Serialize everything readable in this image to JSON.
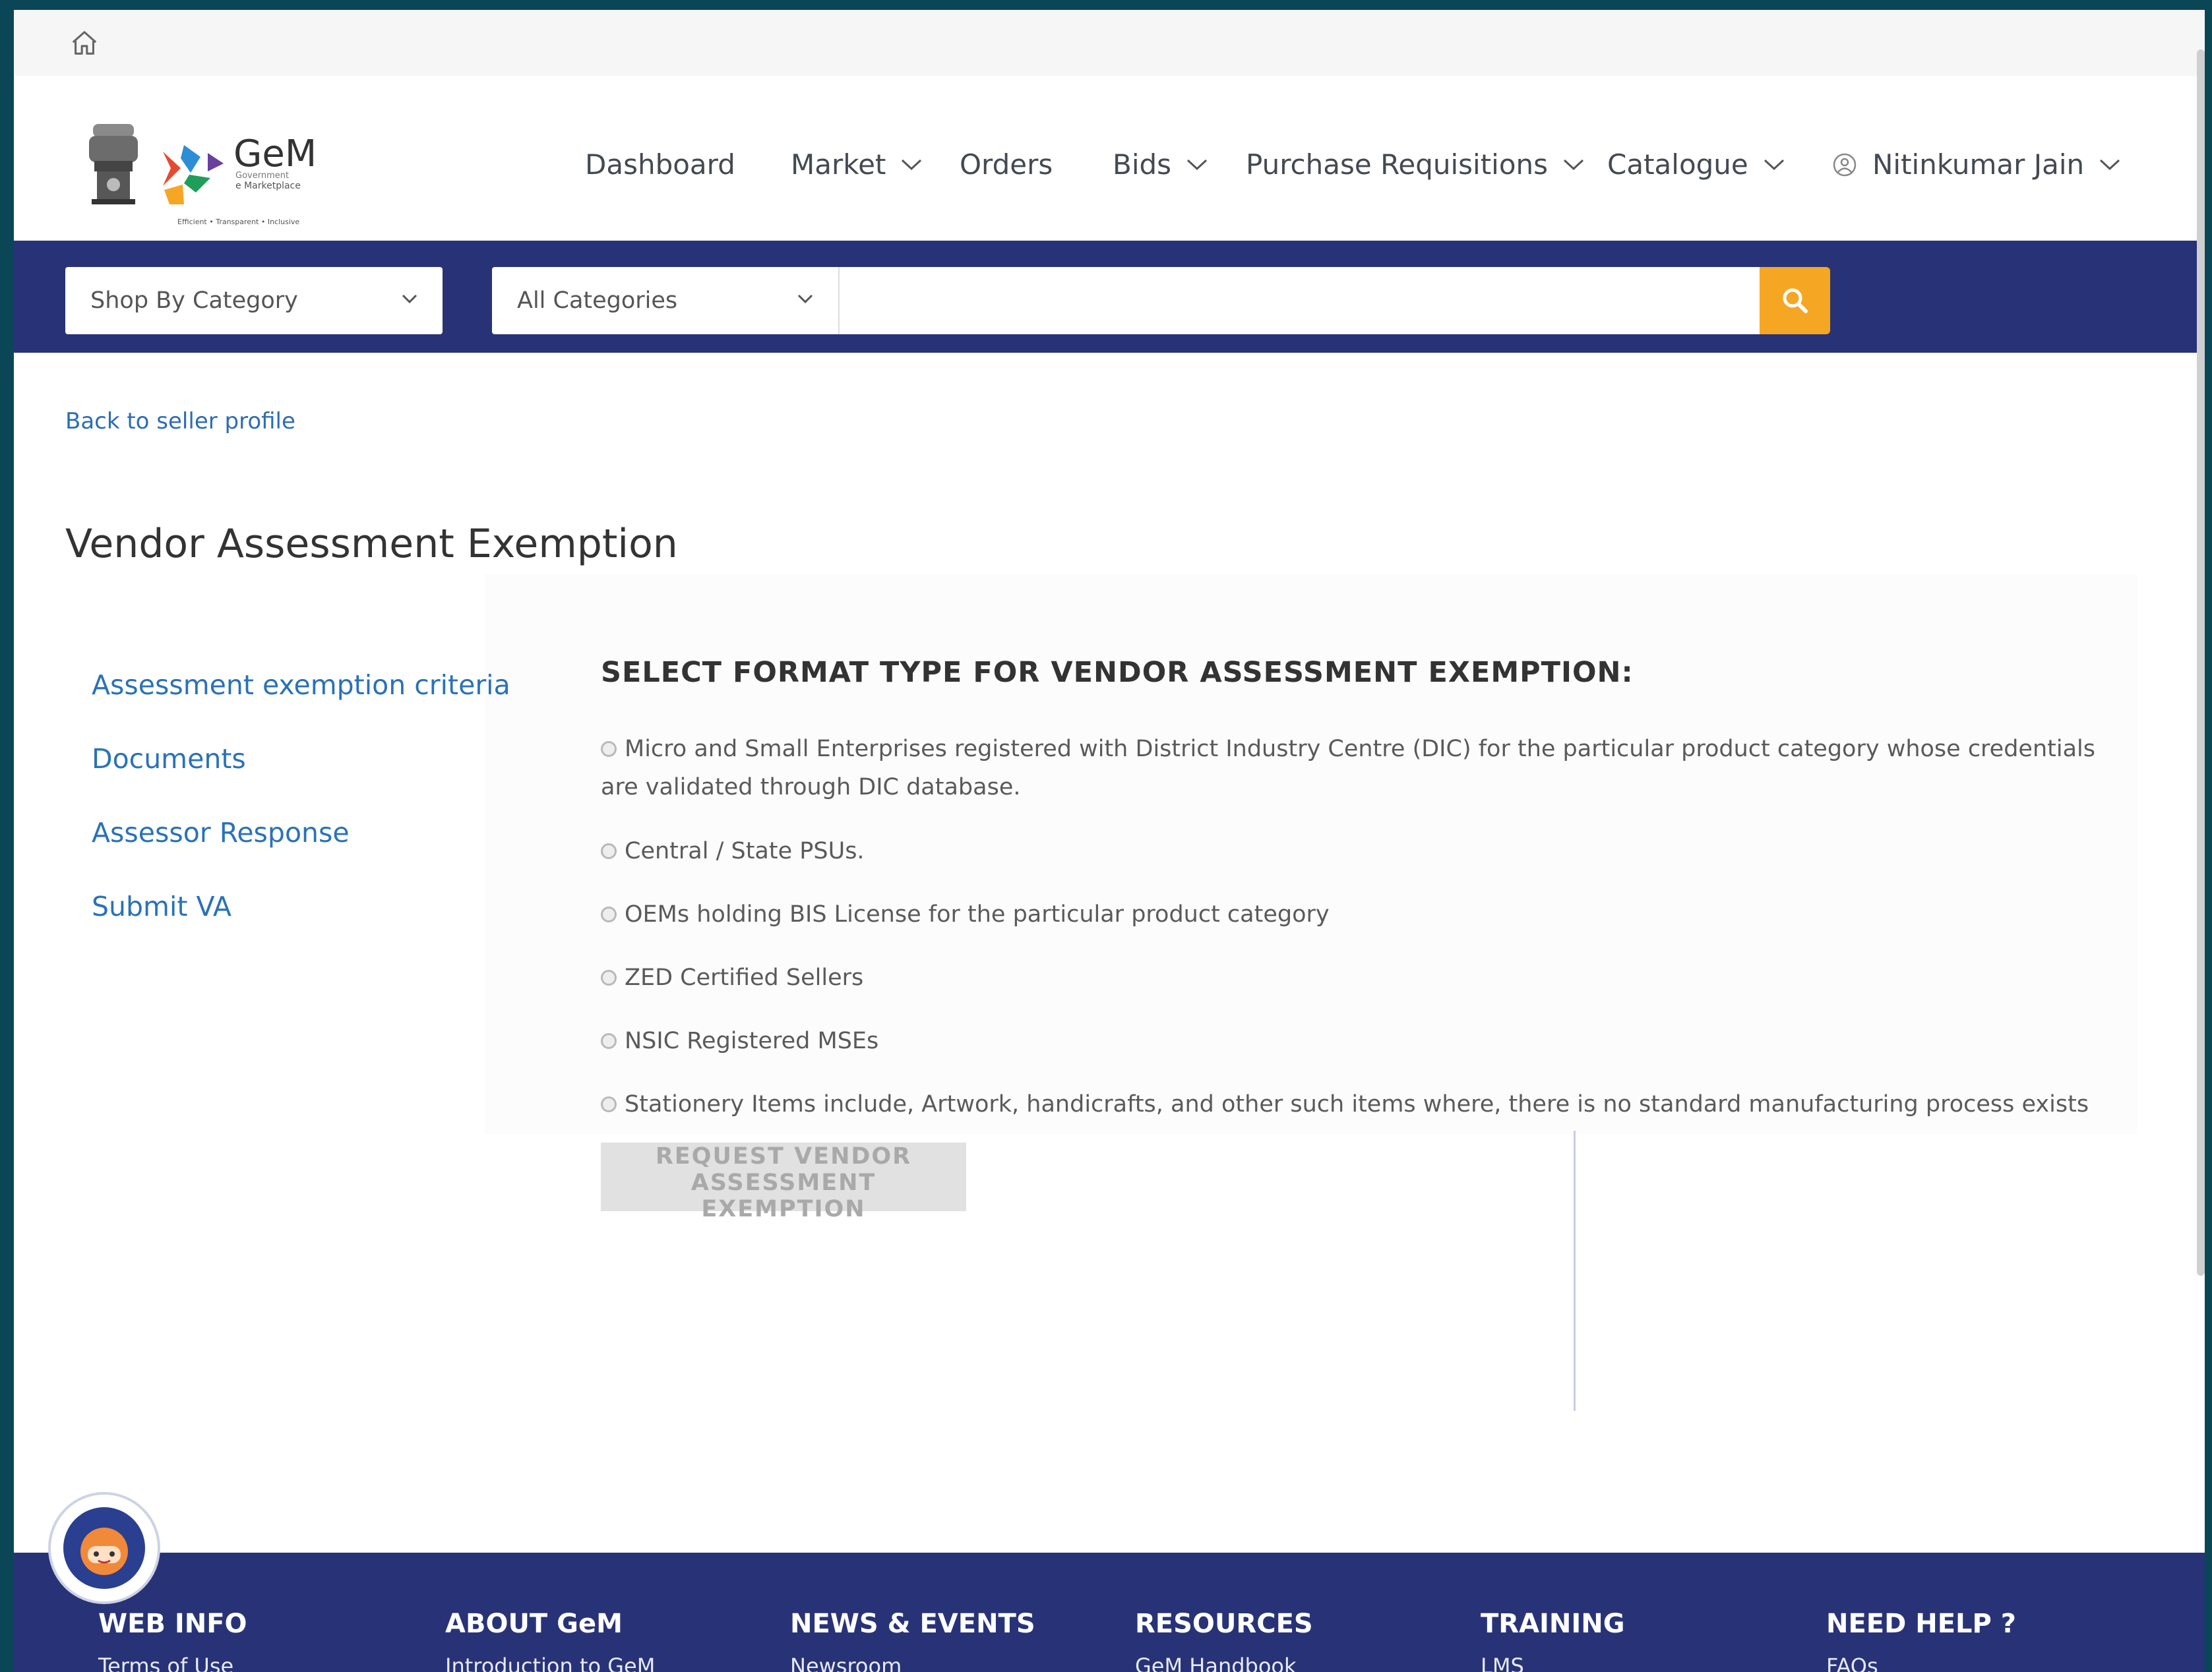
{
  "nav": {
    "dashboard": "Dashboard",
    "market": "Market",
    "orders": "Orders",
    "bids": "Bids",
    "purchase_requisitions": "Purchase Requisitions",
    "catalogue": "Catalogue",
    "user_name": "Nitinkumar Jain"
  },
  "search": {
    "shop_by_category": "Shop By Category",
    "all_categories": "All Categories",
    "query": ""
  },
  "content": {
    "back_link": "Back to seller profile",
    "page_title": "Vendor Assessment Exemption",
    "sidebar": [
      "Assessment exemption criteria",
      "Documents",
      "Assessor Response",
      "Submit VA"
    ],
    "format_heading": "SELECT FORMAT TYPE FOR VENDOR ASSESSMENT EXEMPTION:",
    "options": [
      "Micro and Small Enterprises registered with District Industry Centre (DIC) for the particular product category whose credentials are validated through DIC database.",
      "Central / State PSUs.",
      "OEMs holding BIS License for the particular product category",
      "ZED Certified Sellers",
      "NSIC Registered MSEs",
      "Stationery Items include, Artwork, handicrafts, and other such items where, there is no standard manufacturing process exists"
    ],
    "request_button": "REQUEST VENDOR ASSESSMENT EXEMPTION"
  },
  "footer": {
    "columns": [
      {
        "heading": "WEB INFO",
        "link": "Terms of Use"
      },
      {
        "heading": "ABOUT GeM",
        "link": "Introduction to GeM"
      },
      {
        "heading": "NEWS & EVENTS",
        "link": "Newsroom"
      },
      {
        "heading": "RESOURCES",
        "link": "GeM Handbook"
      },
      {
        "heading": "TRAINING",
        "link": "LMS"
      },
      {
        "heading": "NEED HELP ?",
        "link": "FAQs"
      }
    ]
  },
  "brand": {
    "logo_text": "GeM",
    "logo_sub1": "Government",
    "logo_sub2": "e Marketplace",
    "logo_tagline": "Efficient • Transparent • Inclusive",
    "accent": "#f5a623",
    "band_color": "#283377",
    "link_color": "#2a72b8"
  },
  "icons": {
    "home": "home-icon",
    "search": "search-icon",
    "user": "user-icon",
    "chat": "chat-assistant-icon"
  }
}
